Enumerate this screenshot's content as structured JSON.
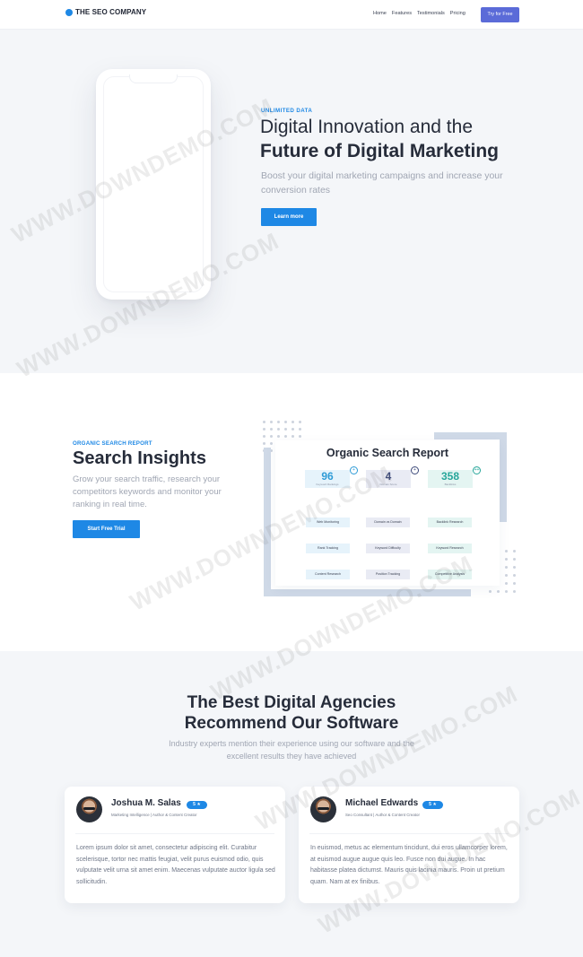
{
  "nav": {
    "logo_text": "THE SEO COMPANY",
    "links": [
      "Home",
      "Features",
      "Testimonials",
      "Pricing"
    ],
    "cta": "Try for Free"
  },
  "hero": {
    "eyebrow": "UNLIMITED DATA",
    "title_line1": "Digital Innovation and the",
    "title_line2": "Future of Digital Marketing",
    "subtitle": "Boost your digital marketing campaigns and increase your conversion rates",
    "button": "Learn more"
  },
  "insights": {
    "eyebrow": "ORGANIC SEARCH REPORT",
    "title": "Search Insights",
    "subtitle": "Grow your search traffic, research your competitors keywords and monitor your ranking in real time.",
    "button": "Start Free Trial",
    "report": {
      "title": "Organic Search Report",
      "stats": [
        {
          "value": "96",
          "caption": "Keyword Rankings",
          "badge": "+",
          "color": "#2e9bd6",
          "bg": "#e6f3fb"
        },
        {
          "value": "4",
          "caption": "Domain Score",
          "badge": "+",
          "color": "#3d4a7a",
          "bg": "#e9ebf4"
        },
        {
          "value": "358",
          "caption": "Backlinks",
          "badge": "++",
          "color": "#26a69a",
          "bg": "#e4f5f2"
        }
      ],
      "chips": [
        "Web Monitoring",
        "Domain vs Domain",
        "Backlink Research",
        "Rank Tracking",
        "Keyword Difficulty",
        "Keyword Research",
        "Content Research",
        "Position Tracking",
        "Competitive Analysis"
      ],
      "chip_colors": [
        "#e6f3fb",
        "#e9ebf4",
        "#e4f5f2"
      ]
    }
  },
  "testimonials": {
    "title_line1": "The Best Digital Agencies",
    "title_line2": "Recommend Our Software",
    "subtitle": "Industry experts mention their experience using our software and the excellent results they have achieved",
    "cards": [
      {
        "name": "Joshua M. Salas",
        "badge": "5 ★",
        "role": "Marketing Intelligence | Author & Content Creator",
        "text": "Lorem ipsum dolor sit amet, consectetur adipiscing elit. Curabitur scelerisque, tortor nec mattis feugiat, velit purus euismod odio, quis vulputate velit urna sit amet enim. Maecenas vulputate auctor ligula sed sollicitudin."
      },
      {
        "name": "Michael Edwards",
        "badge": "5 ★",
        "role": "Seo Consultant | Author & Content Creator",
        "text": "In euismod, metus ac elementum tincidunt, dui eros ullamcorper lorem, at euismod augue augue quis leo. Fusce non dui augue. In hac habitasse platea dictumst. Mauris quis lacinia mauris. Proin ut pretium quam. Nam at ex finibus."
      }
    ]
  },
  "watermark": "WWW.DOWNDEMO.COM"
}
